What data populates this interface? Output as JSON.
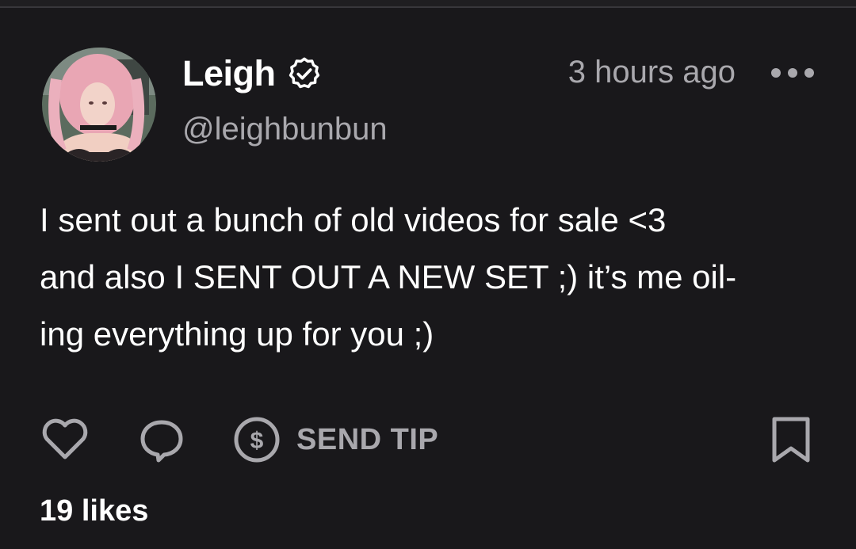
{
  "author": {
    "display_name": "Leigh",
    "handle": "@leighbunbun",
    "verified": true,
    "avatar_icon": "profile-photo"
  },
  "post": {
    "time": "3 hours ago",
    "text": "I sent out a bunch of old videos for sale <3\nand also I SENT OUT A NEW SET ;) it’s me oil-\ning everything up for you ;)",
    "likes_label": "19 likes"
  },
  "actions": {
    "like_icon": "heart-icon",
    "comment_icon": "comment-icon",
    "tip_icon": "dollar-circle-icon",
    "tip_label": "SEND TIP",
    "bookmark_icon": "bookmark-icon",
    "more_icon": "more-dots-icon"
  },
  "colors": {
    "background": "#19181b",
    "primary_text": "#ffffff",
    "secondary_text": "#a9a8ad",
    "icon": "#a9a8ad"
  }
}
